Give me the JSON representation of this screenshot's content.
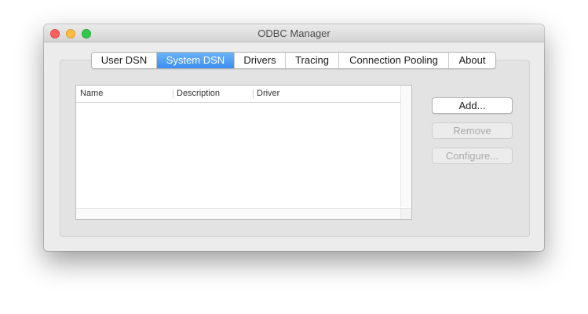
{
  "window": {
    "title": "ODBC Manager"
  },
  "tabs": [
    {
      "label": "User DSN",
      "active": false
    },
    {
      "label": "System DSN",
      "active": true
    },
    {
      "label": "Drivers",
      "active": false
    },
    {
      "label": "Tracing",
      "active": false
    },
    {
      "label": "Connection Pooling",
      "active": false
    },
    {
      "label": "About",
      "active": false
    }
  ],
  "table": {
    "columns": [
      "Name",
      "Description",
      "Driver"
    ],
    "rows": []
  },
  "buttons": {
    "add": {
      "label": "Add...",
      "enabled": true
    },
    "remove": {
      "label": "Remove",
      "enabled": false
    },
    "configure": {
      "label": "Configure...",
      "enabled": false
    }
  },
  "colors": {
    "active_tab": "#3b8ef0",
    "close": "#fc605c",
    "minimize": "#fdbc40",
    "maximize": "#34c84a"
  }
}
